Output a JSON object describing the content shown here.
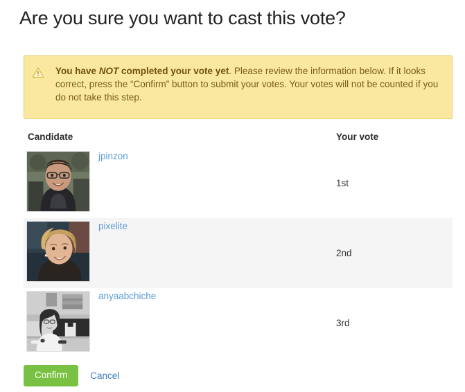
{
  "page": {
    "title": "Are you sure you want to cast this vote?"
  },
  "alert": {
    "icon": "warning-triangle-icon",
    "lead_bold": "You have ",
    "lead_emphasis": "NOT",
    "lead_bold_tail": " completed your vote yet",
    "rest": ". Please review the information below. If it looks correct, press the “Confirm” button to submit your votes. Your votes will not be counted if you do not take this step.",
    "background_color": "#fae8a0",
    "border_color": "#e6cf77",
    "text_color": "#7a5c17"
  },
  "table": {
    "headers": {
      "candidate": "Candidate",
      "vote": "Your vote"
    },
    "rows": [
      {
        "name": "jpinzon",
        "vote": "1st",
        "avatar": "portrait-photo-man-glasses",
        "striped": false
      },
      {
        "name": "pixelite",
        "vote": "2nd",
        "avatar": "portrait-photo-woman-blonde",
        "striped": true
      },
      {
        "name": "anyaabchiche",
        "vote": "3rd",
        "avatar": "portrait-photo-woman-desk-grayscale",
        "striped": false
      }
    ]
  },
  "actions": {
    "confirm_label": "Confirm",
    "cancel_label": "Cancel",
    "confirm_color": "#79c143",
    "cancel_color": "#3a7ec0"
  }
}
